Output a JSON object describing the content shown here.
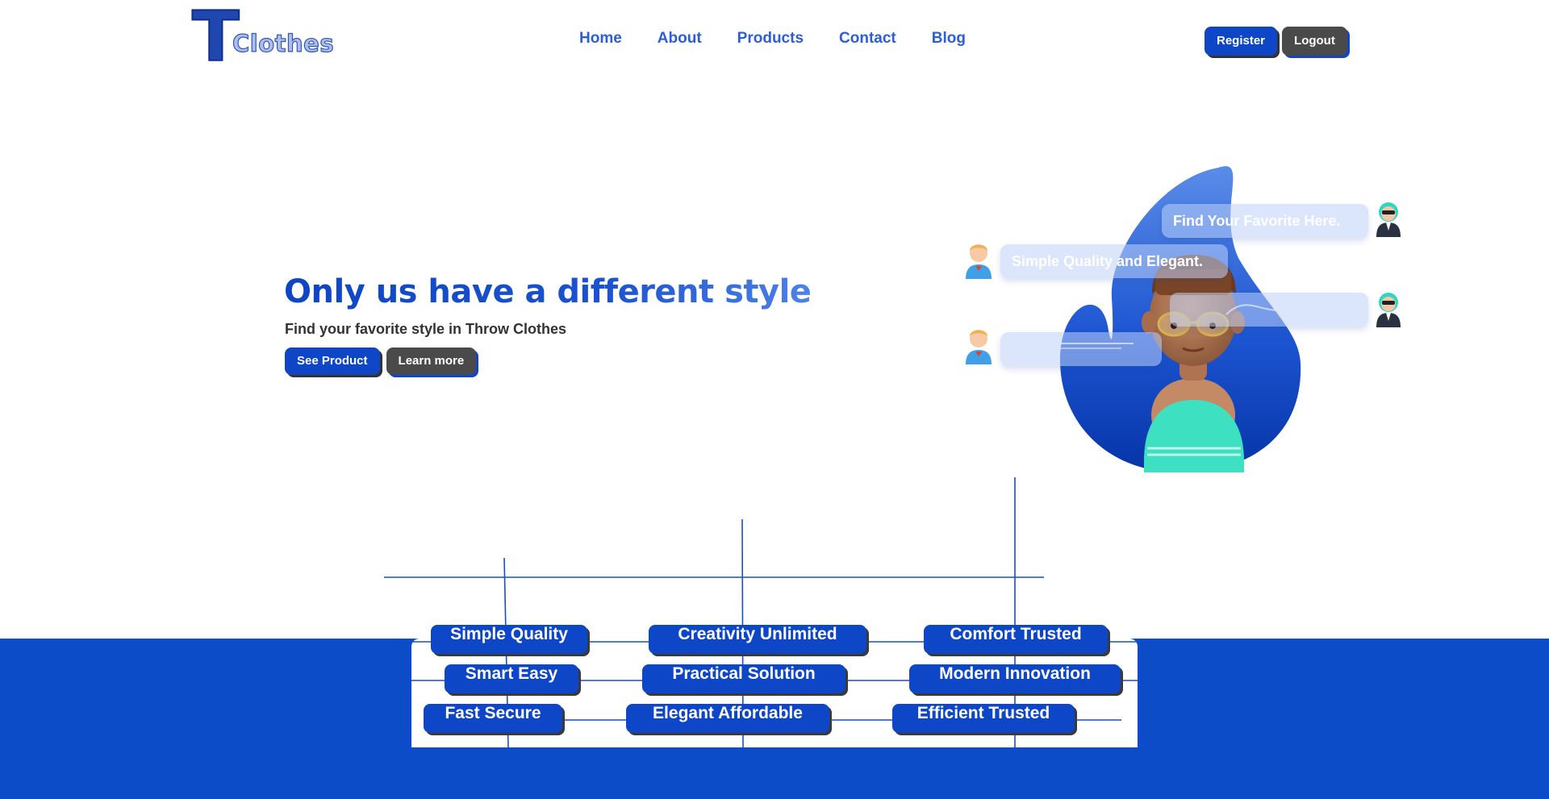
{
  "header": {
    "logo_letter": "T",
    "logo_text": "Clothes",
    "nav": [
      "Home",
      "About",
      "Products",
      "Contact",
      "Blog"
    ],
    "register_label": "Register",
    "logout_label": "Logout"
  },
  "hero": {
    "title": "Only us have a different style",
    "subtitle": "Find your favorite style in Throw Clothes",
    "see_product_label": "See Product",
    "learn_more_label": "Learn more"
  },
  "illustration": {
    "bubble_1": "Find Your Favorite Here.",
    "bubble_2": "Simple Quality and Elegant."
  },
  "tags": [
    "Simple Quality",
    "Creativity Unlimited",
    "Comfort Trusted",
    "Smart Easy",
    "Practical Solution",
    "Modern Innovation",
    "Fast Secure",
    "Elegant Affordable",
    "Efficient Trusted"
  ],
  "colors": {
    "primary": "#0d47c8",
    "dark": "#4a4a4a",
    "nav": "#2b5ed8"
  }
}
